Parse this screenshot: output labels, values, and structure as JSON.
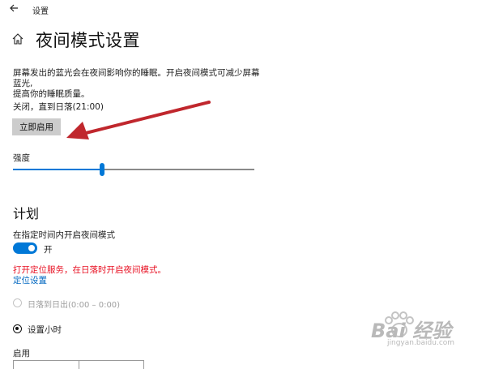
{
  "titlebar": {
    "app_title": "设置"
  },
  "page": {
    "title": "夜间模式设置"
  },
  "description": {
    "line1": "屏幕发出的蓝光会在夜间影响你的睡眠。开启夜间模式可减少屏幕蓝光,",
    "line2": "提高你的睡眠质量。"
  },
  "status_text": "关闭，直到日落(21:00)",
  "enable_button_label": "立即启用",
  "intensity": {
    "label": "强度",
    "value_fraction": 0.37
  },
  "schedule": {
    "section_title": "计划",
    "toggle_label": "在指定时间内开启夜间模式",
    "toggle_state": "开",
    "location_warning": "打开定位服务，在日落时开启夜间模式。",
    "location_link": "定位设置",
    "option_sunset": "日落到日出(0:00 – 0:00)",
    "option_custom": "设置小时",
    "start_label": "启用"
  },
  "watermark": {
    "brand": "Bai  经验",
    "url": "jingyan.baidu.com"
  },
  "colors": {
    "accent": "#0078d7",
    "warning": "#e81123",
    "link": "#0067c0",
    "annotation_arrow": "#c0272d"
  },
  "icons": {
    "back": "back-arrow-icon",
    "home": "home-icon"
  }
}
